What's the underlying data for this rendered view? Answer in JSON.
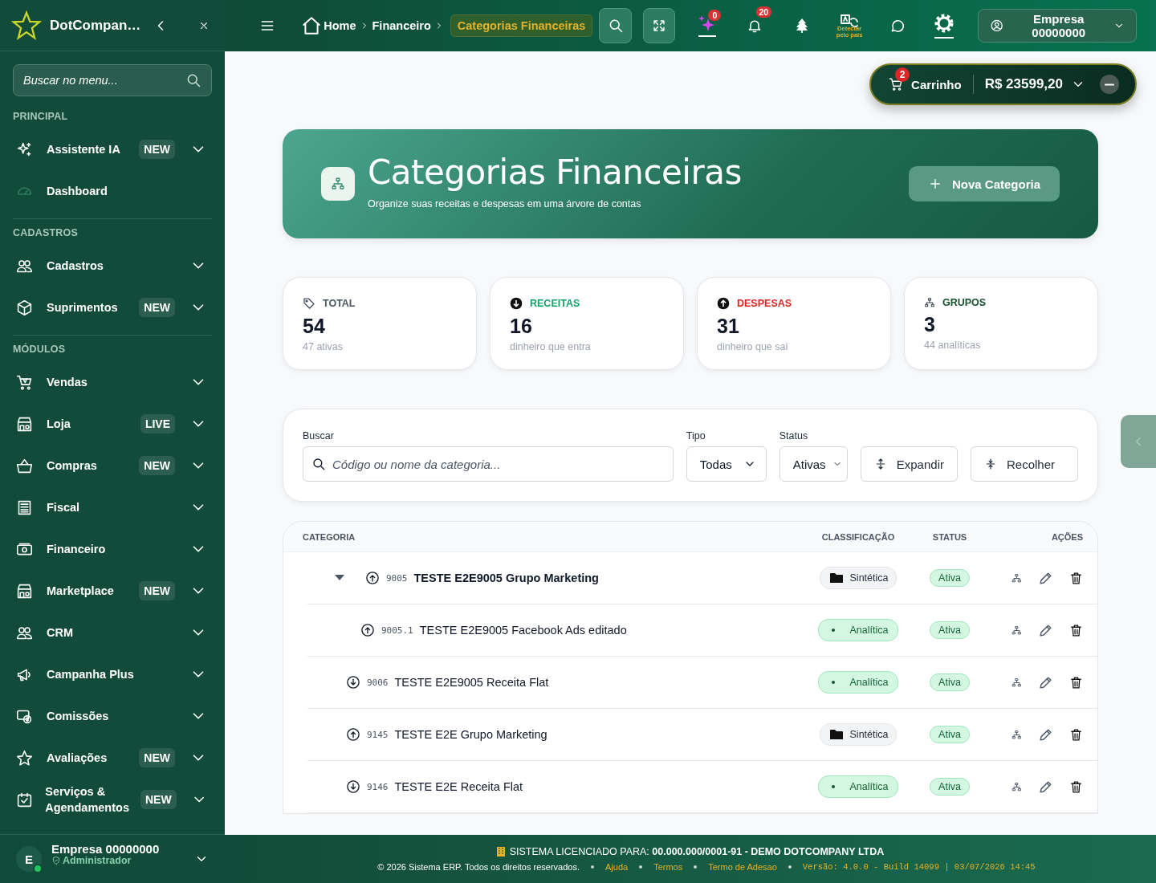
{
  "sidebar": {
    "brand": "DotCompan…",
    "search_placeholder": "Buscar no menu...",
    "sections": [
      {
        "title": "PRINCIPAL",
        "items": [
          {
            "label": "Assistente IA",
            "badge": "NEW",
            "expandable": true
          },
          {
            "label": "Dashboard",
            "expandable": false
          }
        ]
      },
      {
        "title": "CADASTROS",
        "items": [
          {
            "label": "Cadastros",
            "expandable": true
          },
          {
            "label": "Suprimentos",
            "badge": "NEW",
            "expandable": true
          }
        ]
      },
      {
        "title": "MÓDULOS",
        "items": [
          {
            "label": "Vendas",
            "expandable": true
          },
          {
            "label": "Loja",
            "badge": "LIVE",
            "expandable": true
          },
          {
            "label": "Compras",
            "badge": "NEW",
            "expandable": true
          },
          {
            "label": "Fiscal",
            "expandable": true
          },
          {
            "label": "Financeiro",
            "expandable": true
          },
          {
            "label": "Marketplace",
            "badge": "NEW",
            "expandable": true
          },
          {
            "label": "CRM",
            "expandable": true
          },
          {
            "label": "Campanha Plus",
            "expandable": true
          },
          {
            "label": "Comissões",
            "expandable": true
          },
          {
            "label": "Avaliações",
            "badge": "NEW",
            "expandable": true
          },
          {
            "label": "Serviços & Agendamentos",
            "badge": "NEW",
            "expandable": true
          }
        ]
      }
    ],
    "user": {
      "initial": "E",
      "name": "Empresa 00000000",
      "role": "Administrador",
      "online": true
    }
  },
  "topbar": {
    "breadcrumbs": [
      {
        "label": "Home",
        "selected": false
      },
      {
        "label": "Financeiro",
        "selected": false
      },
      {
        "label": "Categorias Financeiras",
        "selected": true
      }
    ],
    "ai_count": "0",
    "notification_count": "20",
    "translate_label": "Detectar pelo pais",
    "account": "Empresa 00000000"
  },
  "cart": {
    "count": "2",
    "label": "Carrinho",
    "total": "R$ 23599,20"
  },
  "header": {
    "title": "Categorias Financeiras",
    "subtitle": "Organize suas receitas e despesas em uma árvore de contas",
    "button": "Nova Categoria"
  },
  "stats": [
    {
      "label": "TOTAL",
      "value": "54",
      "note": "47 ativas",
      "color": "#4b5563"
    },
    {
      "label": "RECEITAS",
      "value": "16",
      "note": "dinheiro que entra",
      "color": "#16a06a"
    },
    {
      "label": "DESPESAS",
      "value": "31",
      "note": "dinheiro que sai",
      "color": "#dc2626"
    },
    {
      "label": "GRUPOS",
      "value": "3",
      "note": "44 analíticas",
      "color": "#14532d"
    }
  ],
  "filters": {
    "search_label": "Buscar",
    "search_placeholder": "Código ou nome da categoria...",
    "type_label": "Tipo",
    "type_value": "Todas",
    "status_label": "Status",
    "status_value": "Ativas",
    "buttons": [
      "Expandir",
      "Recolher"
    ]
  },
  "table": {
    "columns": [
      "CATEGORIA",
      "CLASSIFICAÇÃO",
      "STATUS",
      "AÇÕES"
    ],
    "rows": [
      {
        "code": "9005",
        "name": "TESTE E2E9005 Grupo Marketing",
        "kind": "expense",
        "classification": {
          "label": "Sintética",
          "kind": "group"
        },
        "status": "Ativa",
        "expanded": true,
        "children": [
          {
            "code": "9005.1",
            "name": "TESTE E2E9005 Facebook Ads editado",
            "kind": "expense",
            "classification": {
              "label": "Analítica",
              "kind": "leaf"
            },
            "status": "Ativa"
          }
        ]
      },
      {
        "code": "9006",
        "name": "TESTE E2E9005 Receita Flat",
        "kind": "income",
        "classification": {
          "label": "Analítica",
          "kind": "leaf"
        },
        "status": "Ativa"
      },
      {
        "code": "9145",
        "name": "TESTE E2E Grupo Marketing",
        "kind": "expense",
        "classification": {
          "label": "Sintética",
          "kind": "group"
        },
        "status": "Ativa"
      },
      {
        "code": "9146",
        "name": "TESTE E2E Receita Flat",
        "kind": "income",
        "classification": {
          "label": "Analítica",
          "kind": "leaf"
        },
        "status": "Ativa"
      }
    ]
  },
  "footer": {
    "license": "SISTEMA LICENCIADO PARA: **00.000.000/0001-91 - DEMO DOTCOMPANY LTDA**",
    "copyright": "© 2026 Sistema ERP. Todos os direitos reservados.",
    "links": [
      "Ajuda",
      "Termos",
      "Termo de Adesao"
    ],
    "version": "Versão: 4.0.0 - Build 14099 | 03/07/2026 14:45"
  }
}
